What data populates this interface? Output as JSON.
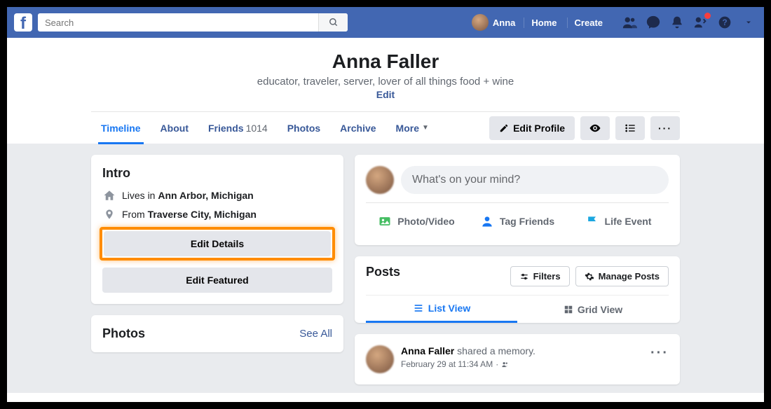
{
  "topbar": {
    "search_placeholder": "Search",
    "user_name": "Anna",
    "links": {
      "home": "Home",
      "create": "Create"
    }
  },
  "profile": {
    "name": "Anna Faller",
    "bio": "educator, traveler, server, lover of all things food + wine",
    "edit_label": "Edit"
  },
  "tabs": [
    {
      "label": "Timeline",
      "active": true
    },
    {
      "label": "About"
    },
    {
      "label": "Friends",
      "count": "1014"
    },
    {
      "label": "Photos"
    },
    {
      "label": "Archive"
    },
    {
      "label": "More"
    }
  ],
  "tab_actions": {
    "edit_profile": "Edit Profile"
  },
  "intro": {
    "title": "Intro",
    "lives_prefix": "Lives in ",
    "lives_place": "Ann Arbor, Michigan",
    "from_prefix": "From ",
    "from_place": "Traverse City, Michigan",
    "edit_details": "Edit Details",
    "edit_featured": "Edit Featured"
  },
  "photos": {
    "title": "Photos",
    "see_all": "See All"
  },
  "composer": {
    "placeholder": "What's on your mind?",
    "photo_video": "Photo/Video",
    "tag_friends": "Tag Friends",
    "life_event": "Life Event"
  },
  "posts_panel": {
    "title": "Posts",
    "filters": "Filters",
    "manage": "Manage Posts",
    "list_view": "List View",
    "grid_view": "Grid View"
  },
  "post": {
    "author": "Anna Faller",
    "action": " shared a memory.",
    "date": "February 29 at 11:34 AM",
    "privacy_sep": " · "
  }
}
